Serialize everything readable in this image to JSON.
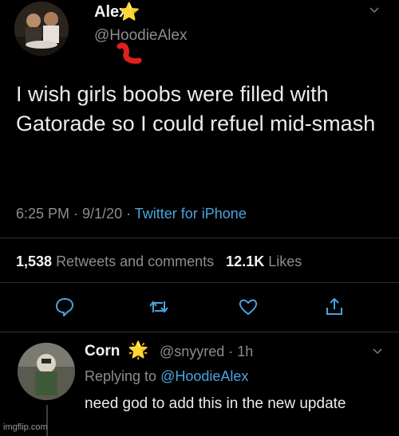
{
  "tweet": {
    "name": "Alex",
    "name_emoji": "⭐",
    "handle": "@HoodieAlex",
    "text": "I wish girls boobs were filled with Gatorade so I could refuel mid-smash",
    "time": "6:25 PM · 9/1/20 ·",
    "source": "Twitter for iPhone",
    "retweets_count": "1,538",
    "retweets_label": "Retweets and comments",
    "likes_count": "12.1K",
    "likes_label": "Likes"
  },
  "reply": {
    "name": "Corn",
    "name_emoji": "🌟",
    "handle_time": "@snyyred · 1h",
    "replying_prefix": "Replying to",
    "replying_to": "@HoodieAlex",
    "text": "need god to add this in the new update"
  },
  "watermark": "imgflip.com",
  "colors": {
    "background": "#000000",
    "link": "#4aa3df",
    "muted": "#8a8d91",
    "divider": "#2c2f33"
  },
  "icons": [
    "reply-icon",
    "retweet-icon",
    "like-icon",
    "share-icon",
    "chevron-down-icon"
  ]
}
